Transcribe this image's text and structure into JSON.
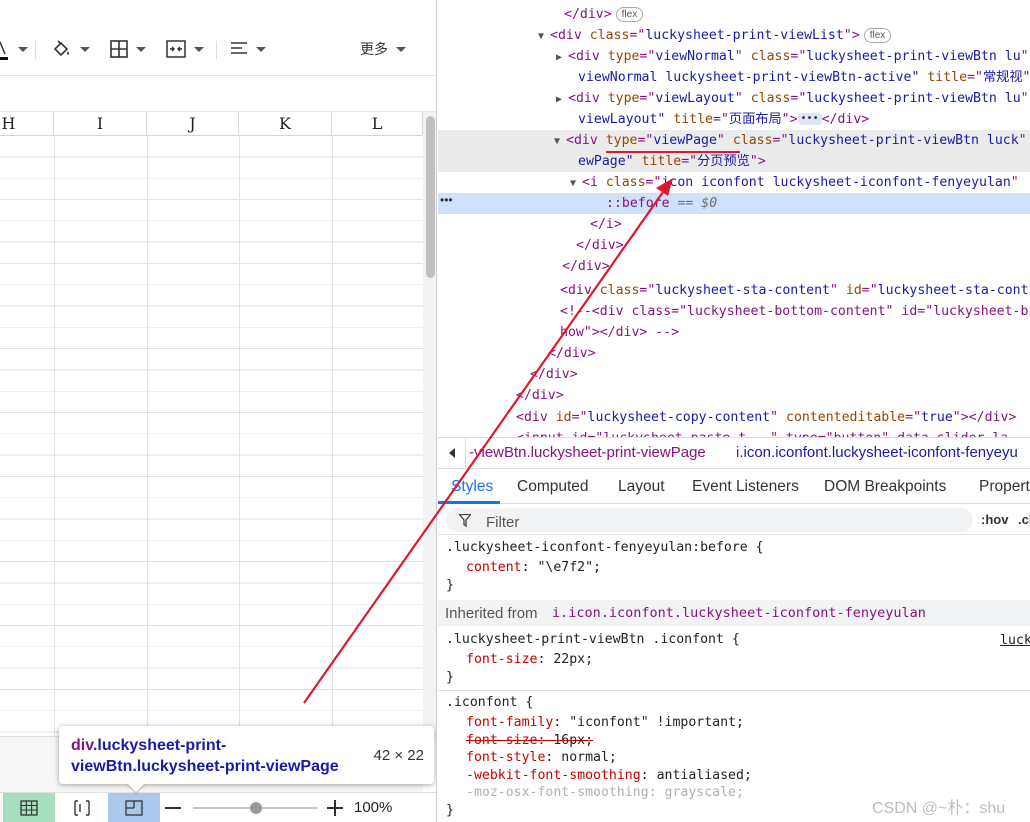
{
  "toolbar": {
    "more_label": "更多"
  },
  "columns": [
    "H",
    "I",
    "J",
    "K",
    "L"
  ],
  "tooltip": {
    "selector_tag": "div",
    "selector_classes": ".luckysheet-print-viewBtn.luckysheet-print-viewPage",
    "size": "42 × 22"
  },
  "statusbar": {
    "zoom": "100%",
    "zoom_level": 0.5,
    "active_view": "viewPage"
  },
  "dom": {
    "lines": [
      {
        "i": 0,
        "html": "</div>",
        "badge": "flex"
      },
      {
        "i": 1,
        "pre": "▼",
        "tag": "div",
        "attrs": [
          [
            "class",
            "luckysheet-print-viewList"
          ]
        ],
        "badge": "flex"
      },
      {
        "i": 2,
        "pre": "▶",
        "tag": "div",
        "attrs": [
          [
            "type",
            "viewNormal"
          ],
          [
            "class",
            "luckysheet-print-viewBtn lu"
          ]
        ]
      },
      {
        "i": 3,
        "cont": "viewNormal luckysheet-print-viewBtn-active\"",
        "attrs2": [
          [
            "title",
            "常规视"
          ]
        ]
      },
      {
        "i": 4,
        "pre": "▶",
        "tag": "div",
        "attrs": [
          [
            "type",
            "viewLayout"
          ],
          [
            "class",
            "luckysheet-print-viewBtn lu"
          ]
        ]
      },
      {
        "i": 5,
        "cont": "viewLayout\"",
        "attrs2": [
          [
            "title",
            "页面布局"
          ]
        ],
        "dots": true,
        "tail": "</div>"
      },
      {
        "i": 6,
        "pre": "▼",
        "tag": "div",
        "attrs": [
          [
            "type",
            "viewPage"
          ],
          [
            "class",
            "luckysheet-print-viewBtn luck"
          ]
        ]
      },
      {
        "i": 7,
        "cont": "ewPage\"",
        "attrs2": [
          [
            "title",
            "分页预览"
          ]
        ],
        "close": ">"
      },
      {
        "i": 8,
        "pre": "▼",
        "tag": "i",
        "attrs": [
          [
            "class",
            "icon iconfont luckysheet-iconfont-fenyeyulan"
          ]
        ]
      },
      {
        "i": 9,
        "pseudo": "::before",
        "eq": "== $0"
      },
      {
        "i": 10,
        "html": "</i>"
      },
      {
        "i": 11,
        "html": "</div>"
      },
      {
        "i": 12,
        "html": "</div>"
      },
      {
        "i": 13,
        "tag": "div",
        "attrs": [
          [
            "class",
            "luckysheet-sta-content"
          ],
          [
            "id",
            "luckysheet-sta-cont"
          ]
        ]
      },
      {
        "i": 14,
        "comment": "<!--<div class=\"luckysheet-bottom-content\" id=\"luckysheet-b"
      },
      {
        "i": 15,
        "comment": "how\"></div> -->"
      },
      {
        "i": 16,
        "html": "</div>"
      },
      {
        "i": 17,
        "html": "</div>"
      },
      {
        "i": 18,
        "html": "</div>"
      },
      {
        "i": 19,
        "tag": "div",
        "attrs": [
          [
            "id",
            "luckysheet-copy-content"
          ],
          [
            "contenteditable",
            "true"
          ]
        ],
        "tail": "</div>"
      },
      {
        "i": 20,
        "html": "<input id=\"luckysheet-paste-t...\" type=\"button\" data-slider-la..."
      }
    ]
  },
  "breadcrumbs": [
    {
      "tag": "",
      "cls": "-viewBtn.luckysheet-print-viewPage"
    },
    {
      "tag": "i",
      "cls": ".icon.iconfont.luckysheet-iconfont-fenyeyu"
    }
  ],
  "tabs": [
    "Styles",
    "Computed",
    "Layout",
    "Event Listeners",
    "DOM Breakpoints",
    "Propert"
  ],
  "filter": {
    "placeholder": "Filter",
    "hov": ":hov",
    "cls": ".cl"
  },
  "styles": {
    "rule1_selector": ".luckysheet-iconfont-fenyeyulan:before {",
    "rule1_prop": "content",
    "rule1_val": "\"\\e7f2\";",
    "inherited_label": "Inherited from",
    "inherited_link": "i.icon.iconfont.luckysheet-iconfont-fenyeyulan",
    "rule2_selector": ".luckysheet-print-viewBtn .iconfont {",
    "rule2_source": "luck",
    "rule2_prop": "font-size",
    "rule2_val": "22px;",
    "rule3_selector": ".iconfont {",
    "rule3_props": [
      {
        "p": "font-family",
        "v": "\"iconfont\" !important;",
        "state": "normal"
      },
      {
        "p": "font-size",
        "v": "16px;",
        "state": "struck"
      },
      {
        "p": "font-style",
        "v": "normal;",
        "state": "normal"
      },
      {
        "p": "-webkit-font-smoothing",
        "v": "antialiased;",
        "state": "normal"
      },
      {
        "p": "-moz-osx-font-smoothing",
        "v": "grayscale;",
        "state": "muted"
      }
    ],
    "close_brace": "}"
  },
  "watermark": "CSDN @~朴：shu",
  "colors": {
    "tag": "#881280",
    "attr_name": "#994500",
    "attr_value": "#1a1aa6",
    "css_prop": "#c80000",
    "accent": "#1a73e8",
    "arrow": "#e0182d",
    "selected_row": "#cfe1fb"
  }
}
